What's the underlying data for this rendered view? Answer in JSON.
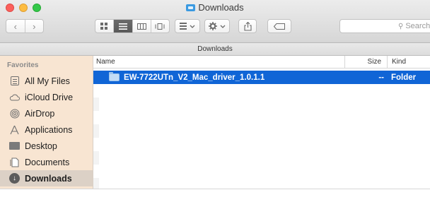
{
  "window": {
    "title": "Downloads"
  },
  "toolbar": {
    "back_label": "‹",
    "forward_label": "›",
    "view_icons": [
      "icon-view",
      "list-view",
      "column-view",
      "coverflow-view"
    ],
    "search_placeholder": "Search"
  },
  "pathbar": {
    "label": "Downloads"
  },
  "sidebar": {
    "heading": "Favorites",
    "items": [
      {
        "label": "All My Files",
        "icon": "all-files-icon",
        "selected": false
      },
      {
        "label": "iCloud Drive",
        "icon": "cloud-icon",
        "selected": false
      },
      {
        "label": "AirDrop",
        "icon": "airdrop-icon",
        "selected": false
      },
      {
        "label": "Applications",
        "icon": "applications-icon",
        "selected": false
      },
      {
        "label": "Desktop",
        "icon": "desktop-icon",
        "selected": false
      },
      {
        "label": "Documents",
        "icon": "documents-icon",
        "selected": false
      },
      {
        "label": "Downloads",
        "icon": "downloads-icon",
        "selected": true
      }
    ]
  },
  "filelist": {
    "columns": {
      "name": "Name",
      "size": "Size",
      "kind": "Kind"
    },
    "rows": [
      {
        "name": "EW-7722UTn_V2_Mac_driver_1.0.1.1",
        "size": "--",
        "kind": "Folder",
        "selected": true
      }
    ]
  },
  "colors": {
    "sidebar_bg": "#f8e5d2",
    "selection_blue": "#1065d6",
    "folder_blue": "#3b9ae1"
  }
}
